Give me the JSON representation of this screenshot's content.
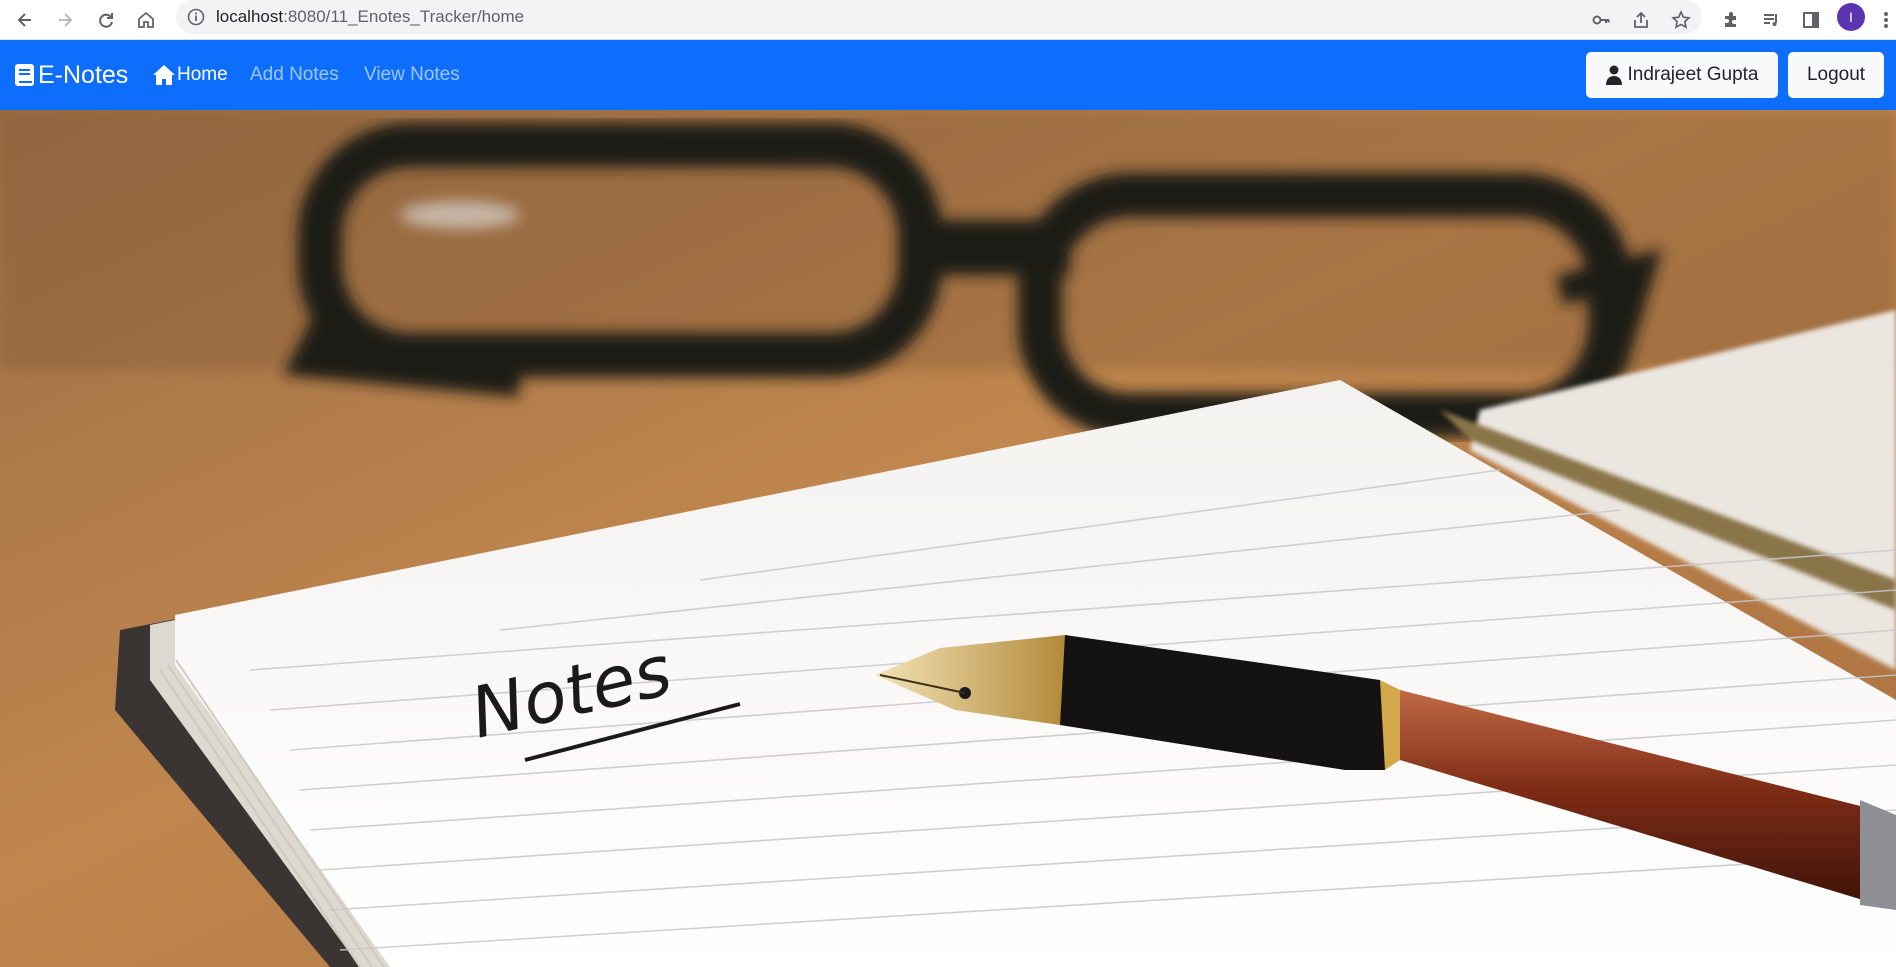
{
  "browser": {
    "url_host": "localhost",
    "url_path": ":8080/11_Enotes_Tracker/home",
    "profile_initial": "I"
  },
  "navbar": {
    "brand": "E-Notes",
    "links": [
      {
        "label": "Home",
        "active": true
      },
      {
        "label": "Add Notes",
        "active": false
      },
      {
        "label": "View Notes",
        "active": false
      }
    ],
    "user_button": "Indrajeet Gupta",
    "logout_button": "Logout",
    "color": "#0d6efd"
  },
  "hero": {
    "handwritten_text": "Notes",
    "icons": [
      "glasses",
      "notebook",
      "fountain-pen"
    ]
  }
}
